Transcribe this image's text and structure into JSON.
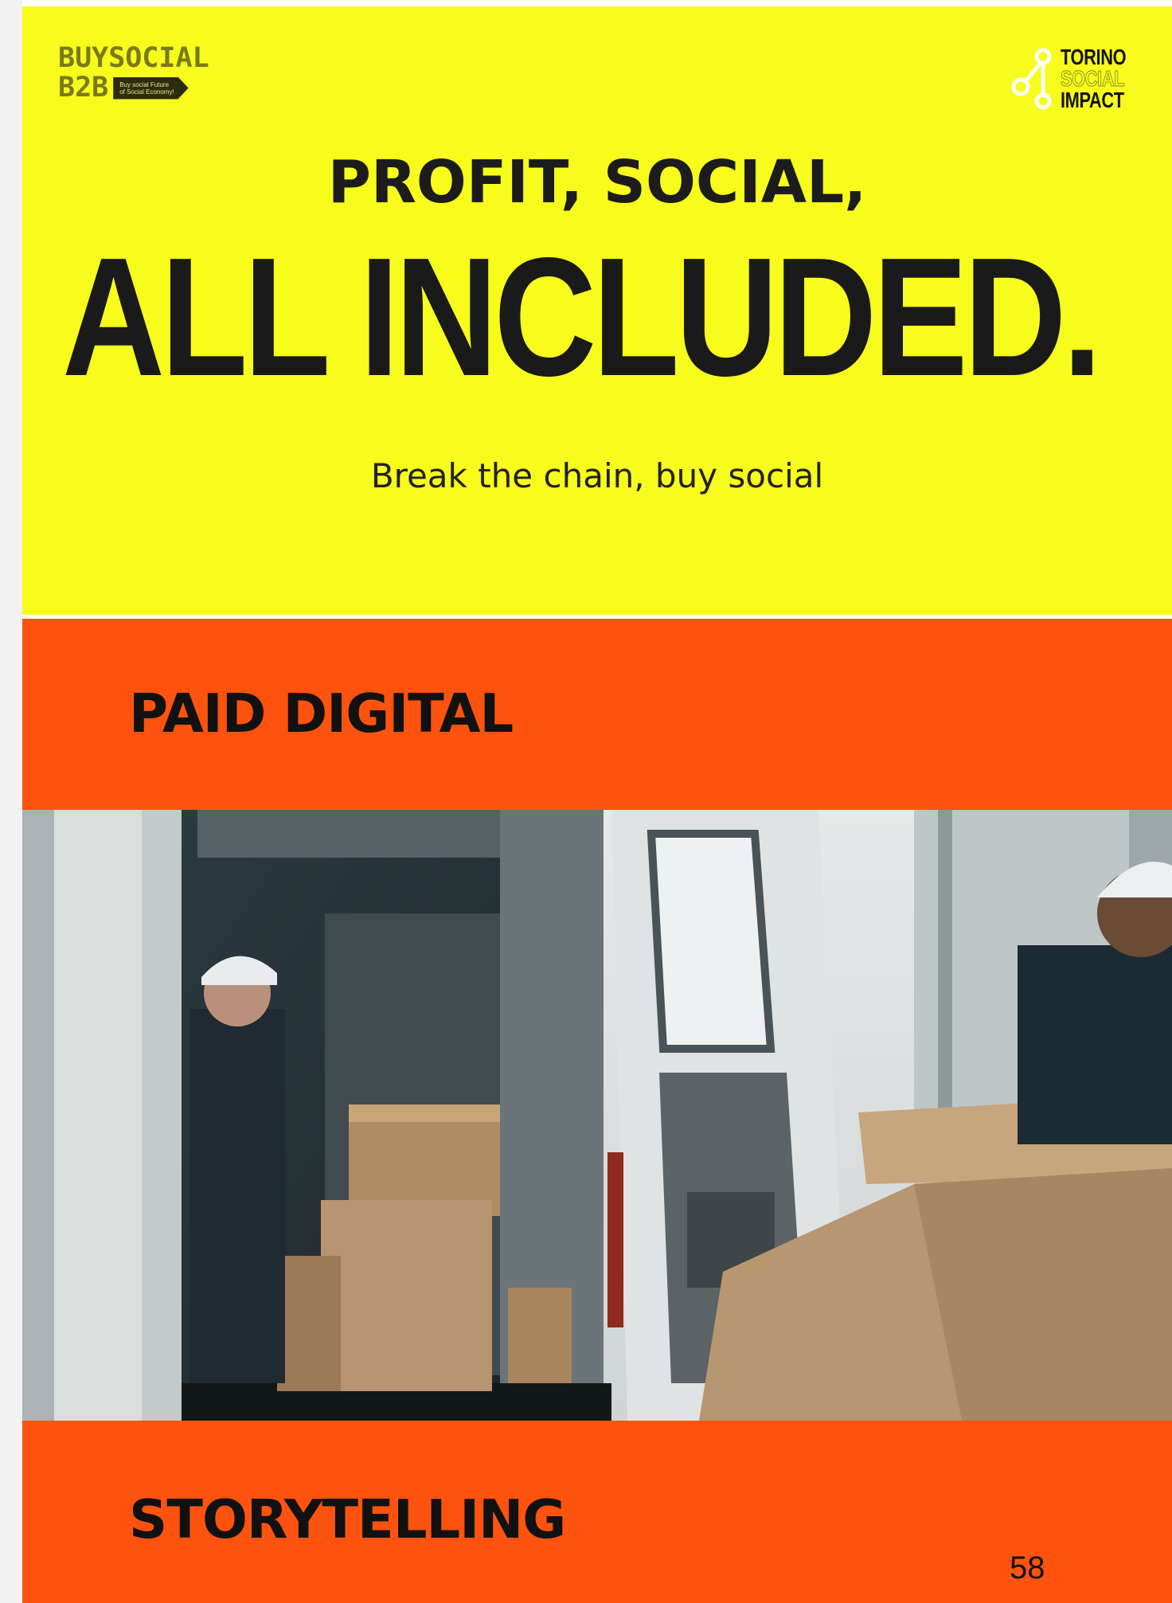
{
  "banner": {
    "logo_left": {
      "line1": "BUYSOCIAL",
      "line2": "B2B",
      "tag_line1": "Buy social Future",
      "tag_line2": "of Social Economy!"
    },
    "logo_right": {
      "word1": "TORINO",
      "word2": "SOCIAL",
      "word3": "IMPACT"
    },
    "headline_small": "PROFIT, SOCIAL,",
    "headline_big": "ALL INCLUDED.",
    "tagline": "Break the chain, buy social"
  },
  "sections": {
    "paid_digital": "PAID DIGITAL",
    "storytelling": "STORYTELLING"
  },
  "page_number": "58",
  "colors": {
    "banner_yellow": "#f7fc1d",
    "section_orange": "#fe530f",
    "text_dark": "#111111"
  }
}
